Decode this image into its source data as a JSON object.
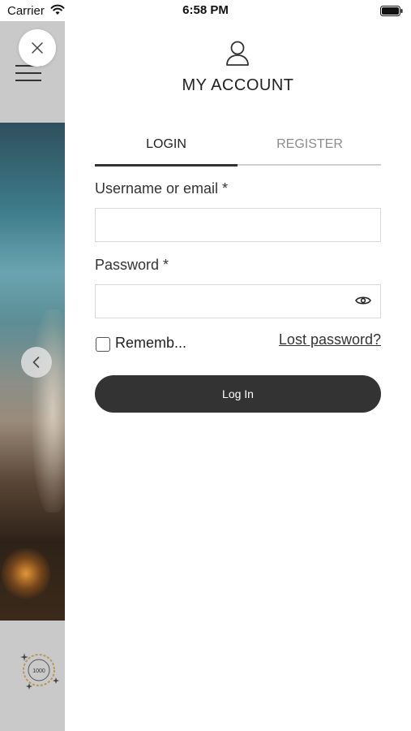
{
  "status_bar": {
    "carrier": "Carrier",
    "time": "6:58 PM"
  },
  "drawer": {
    "title": "MY ACCOUNT",
    "tabs": [
      {
        "label": "LOGIN",
        "active": true
      },
      {
        "label": "REGISTER",
        "active": false
      }
    ],
    "form": {
      "username_label": "Username or email  *",
      "username_value": "",
      "password_label": "Password *",
      "password_value": "",
      "remember_label": "Rememb...",
      "remember_checked": false,
      "lost_password": "Lost password?",
      "submit_label": "Log In"
    }
  },
  "background": {
    "badge_text": "1000"
  },
  "icons": {
    "close": "close-icon",
    "menu": "hamburger-menu-icon",
    "user": "user-icon",
    "eye": "eye-icon",
    "prev": "chevron-left-icon"
  },
  "colors": {
    "accent": "#333333",
    "tab_inactive": "#8c8c8c",
    "side_strip": "#c9c9c9"
  }
}
